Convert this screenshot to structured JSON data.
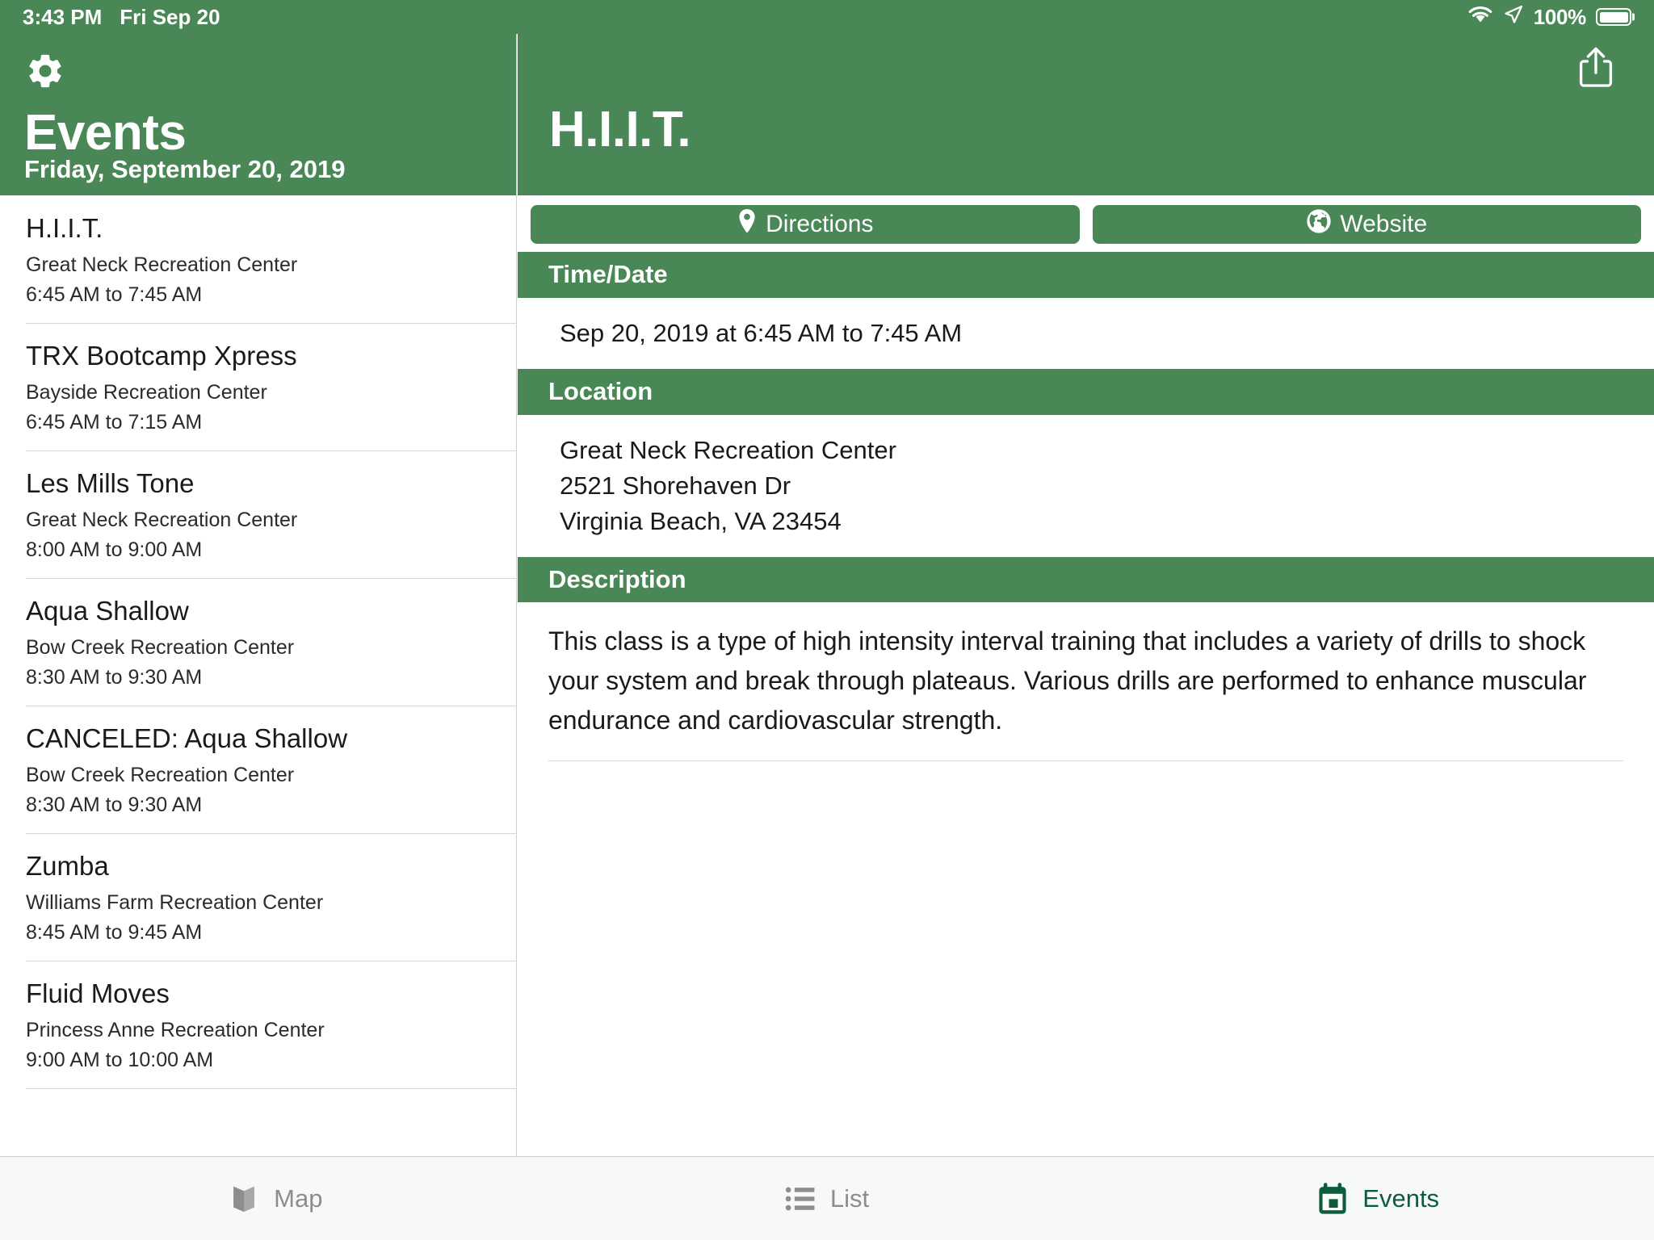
{
  "colors": {
    "brand_green": "#4a8757",
    "tab_active": "#0d5c3c",
    "tab_inactive": "#8d8d8d",
    "tabbar_bg": "#f7f8f8",
    "text_primary": "#1a1a1a"
  },
  "status_bar": {
    "time": "3:43 PM",
    "date": "Fri Sep 20",
    "wifi_icon": "wifi-icon",
    "location_icon": "location-arrow-icon",
    "battery_percent": "100%",
    "battery_icon": "battery-full-icon"
  },
  "sidebar": {
    "settings_icon": "gear-icon",
    "title": "Events",
    "date_header": "Friday, September 20, 2019",
    "events": [
      {
        "title": "H.I.I.T.",
        "location": "Great Neck Recreation Center",
        "time": "6:45 AM to 7:45 AM"
      },
      {
        "title": "TRX Bootcamp Xpress",
        "location": "Bayside Recreation Center",
        "time": "6:45 AM to 7:15 AM"
      },
      {
        "title": "Les Mills Tone",
        "location": "Great Neck Recreation Center",
        "time": "8:00 AM to 9:00 AM"
      },
      {
        "title": "Aqua Shallow",
        "location": "Bow Creek Recreation Center",
        "time": "8:30 AM to 9:30 AM"
      },
      {
        "title": "CANCELED: Aqua Shallow",
        "location": "Bow Creek Recreation Center",
        "time": "8:30 AM to 9:30 AM"
      },
      {
        "title": "Zumba",
        "location": "Williams Farm Recreation Center",
        "time": "8:45 AM to 9:45 AM"
      },
      {
        "title": "Fluid Moves",
        "location": "Princess Anne Recreation Center",
        "time": "9:00 AM to 10:00 AM"
      }
    ]
  },
  "detail": {
    "title": "H.I.I.T.",
    "share_icon": "share-icon",
    "actions": [
      {
        "label": "Directions",
        "icon": "map-pin-icon"
      },
      {
        "label": "Website",
        "icon": "globe-icon"
      }
    ],
    "sections": {
      "timedate": {
        "header": "Time/Date",
        "value": "Sep 20, 2019 at 6:45 AM to 7:45 AM"
      },
      "location": {
        "header": "Location",
        "lines": [
          "Great Neck Recreation Center",
          "2521 Shorehaven Dr",
          "Virginia Beach, VA 23454"
        ]
      },
      "description": {
        "header": "Description",
        "text": "This class is a type of high intensity interval training that includes a variety of drills to shock your system and break through plateaus. Various drills are performed to enhance muscular endurance and cardiovascular strength."
      }
    }
  },
  "tabbar": {
    "tabs": [
      {
        "label": "Map",
        "icon": "map-icon",
        "active": false
      },
      {
        "label": "List",
        "icon": "list-icon",
        "active": false
      },
      {
        "label": "Events",
        "icon": "calendar-icon",
        "active": true
      }
    ]
  }
}
